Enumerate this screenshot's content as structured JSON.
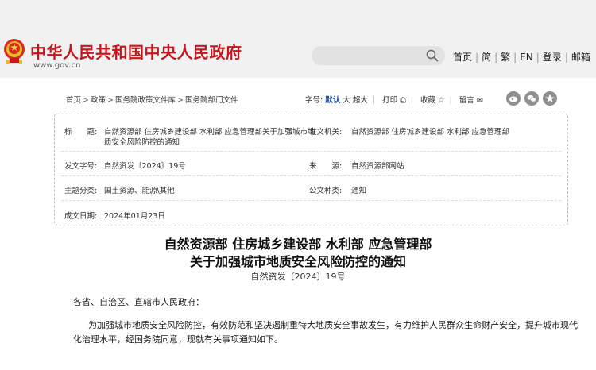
{
  "header": {
    "site_title": "中华人民共和国中央人民政府",
    "site_url": "www.gov.cn",
    "nav": [
      "首页",
      "简",
      "繁",
      "EN",
      "登录",
      "邮箱"
    ]
  },
  "breadcrumb": [
    "首页",
    "政策",
    "国务院政策文件库",
    "国务院部门文件"
  ],
  "tools": {
    "font_label": "字号:",
    "font_default": "默认",
    "font_large": "大",
    "font_xlarge": "超大",
    "print": "打印",
    "favorite": "收藏",
    "comment": "留言"
  },
  "info": {
    "title_label": "标　　题:",
    "title_line1": "自然资源部 住房城乡建设部 水利部 应急管理部关于加强城市地",
    "title_line2": "质安全风险防控的通知",
    "issuer_label": "发文机关:",
    "issuer_value": "自然资源部 住房城乡建设部 水利部 应急管理部",
    "docno_label": "发文字号:",
    "docno_value": "自然资发〔2024〕19号",
    "source_label": "来　　源:",
    "source_value": "自然资源部网站",
    "category_label": "主题分类:",
    "category_value": "国土资源、能源\\其他",
    "type_label": "公文种类:",
    "type_value": "通知",
    "date_label": "成文日期:",
    "date_value": "2024年01月23日"
  },
  "document": {
    "title_line1": "自然资源部 住房城乡建设部 水利部 应急管理部",
    "title_line2": "关于加强城市地质安全风险防控的通知",
    "doc_number": "自然资发〔2024〕19号",
    "salutation": "各省、自治区、直辖市人民政府：",
    "para1_line1": "为加强城市地质安全风险防控，有效防范和坚决遏制重特大地质安全事故发生，有力维护人民群众生命财产安全，提升城市现代",
    "para1_line2": "化治理水平，经国务院同意，现就有关事项通知如下。"
  }
}
